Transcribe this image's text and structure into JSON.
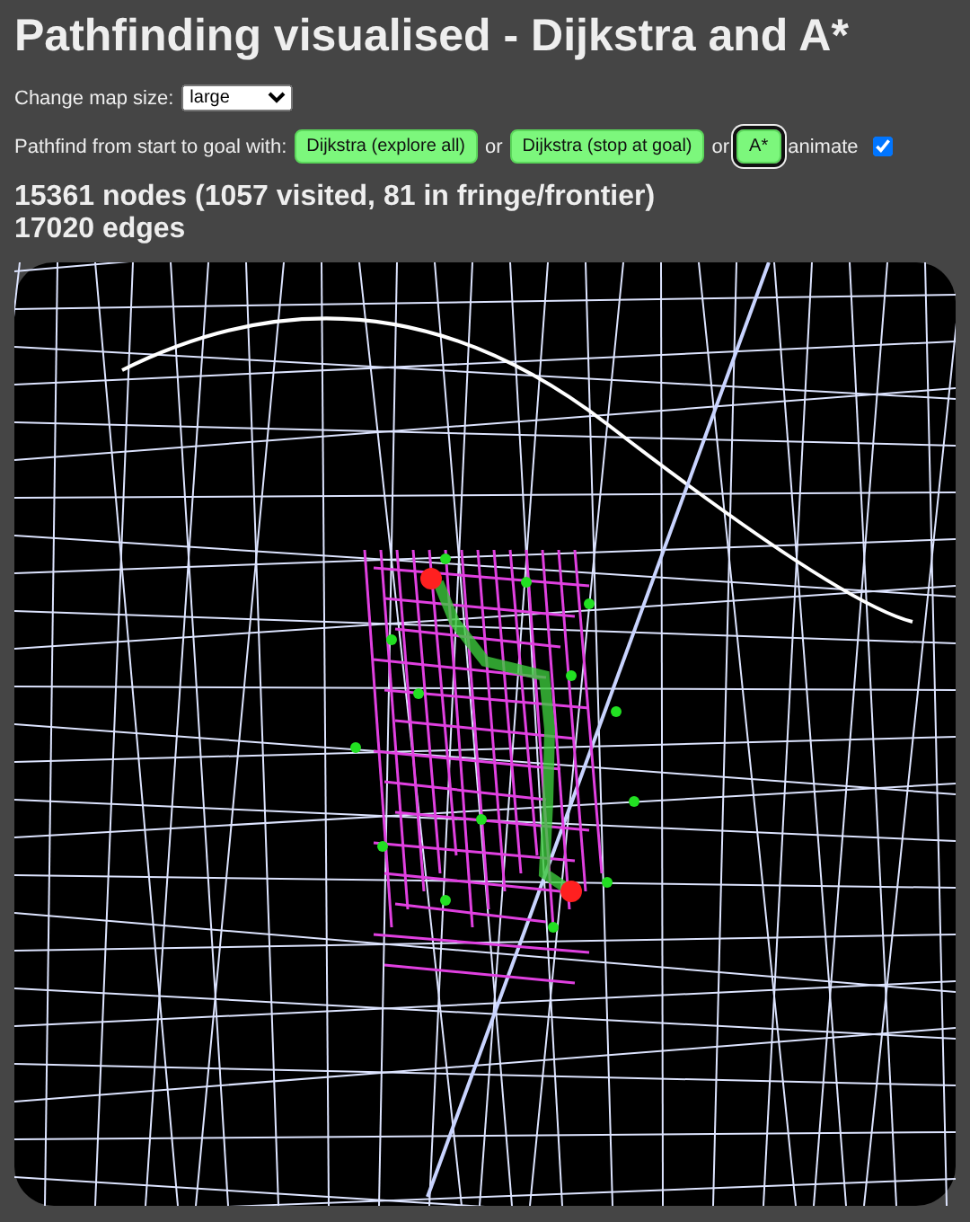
{
  "title": "Pathfinding visualised - Dijkstra and A*",
  "map_size": {
    "label": "Change map size:",
    "value": "large"
  },
  "pathfind": {
    "label": "Pathfind from start to goal with:",
    "items": [
      {
        "kind": "button",
        "text": "Dijkstra (explore all)",
        "selected": false
      },
      {
        "kind": "text",
        "text": "or"
      },
      {
        "kind": "button",
        "text": "Dijkstra (stop at goal)",
        "selected": false
      },
      {
        "kind": "text",
        "text": "or"
      },
      {
        "kind": "button",
        "text": "A*",
        "selected": true
      },
      {
        "kind": "text",
        "text": "animate"
      },
      {
        "kind": "checkbox",
        "checked": true
      }
    ]
  },
  "stats": [
    "15361 nodes (1057 visited, 81 in fringe/frontier)",
    "17020 edges"
  ]
}
